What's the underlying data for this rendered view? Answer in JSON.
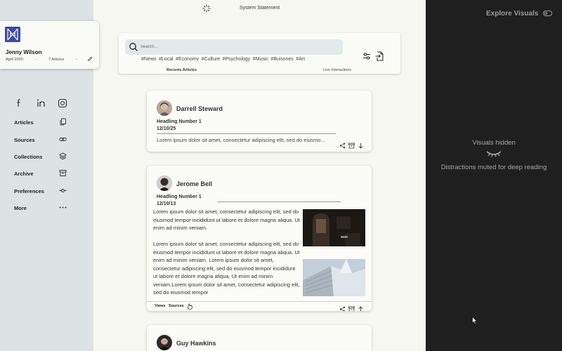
{
  "profile": {
    "name": "Jenny Wilson",
    "joined": "April 2020",
    "separator": "-",
    "articles": "7 Articles"
  },
  "nav": {
    "items": [
      {
        "label": "Articles",
        "icon": "copy-icon"
      },
      {
        "label": "Sources",
        "icon": "link-icon"
      },
      {
        "label": "Collections",
        "icon": "layers-icon"
      },
      {
        "label": "Archive",
        "icon": "archive-icon"
      },
      {
        "label": "Preferences",
        "icon": "commit-icon"
      },
      {
        "label": "More",
        "icon": "more-dots-icon"
      }
    ]
  },
  "socials": [
    "facebook-icon",
    "linkedin-icon",
    "instagram-icon"
  ],
  "status": {
    "text": "System Statement"
  },
  "search": {
    "placeholder": "Search...",
    "tags": [
      "#News",
      "#Local",
      "#Economy",
      "#Culture",
      "#Psychology",
      "#Music",
      "#Buissnes",
      "#Art"
    ],
    "recent_label": "Recents Articles",
    "live_label": "Live Interactions"
  },
  "cards": [
    {
      "author": "Darrell Steward",
      "headline": "Headling Number 1",
      "date": "12/10/25",
      "excerpt": "Lorem ipsum dolor sit amet, consectetur adipiscing elit, sed do eiusmo..."
    },
    {
      "author": "Jerome Bell",
      "headline": "Headling Number 1",
      "date": "12/10/13",
      "paragraph1": "Lorem ipsum dolor sit amet, consectetur adipiscing elit, sed do eiusmod tempor incididunt ut labore et dolore magna aliqua. Ut enim ad minim veniam.",
      "paragraph2": "Lorem ipsum dolor sit amet, consectetur adipiscing elit, sed do eiusmod tempor incididunt ut labore et dolore magna aliqua. Ut enim ad minim veniam. Lorem ipsum dolor sit amet, consectetur adipiscing elit, sed do eiusmod tempor incididunt ut labore et dolore magna aliqua. Ut enim ad minim veniam.Lorem ipsum dolor sit amet, consectetur adipiscing elit, sed do eiusmod tempor",
      "views_label": "Views",
      "sources_label": "Sources"
    },
    {
      "author": "Guy Hawkins"
    }
  ],
  "right_panel": {
    "title": "Explore Visuals",
    "hidden_title": "Visuals hidden",
    "muted_text": "Distractions muted for deep reading"
  },
  "colors": {
    "accent": "#3b4aa8",
    "sidebar": "#dde3e4",
    "main_bg": "#f7f7f2",
    "dark_panel": "#1f1f1f"
  }
}
